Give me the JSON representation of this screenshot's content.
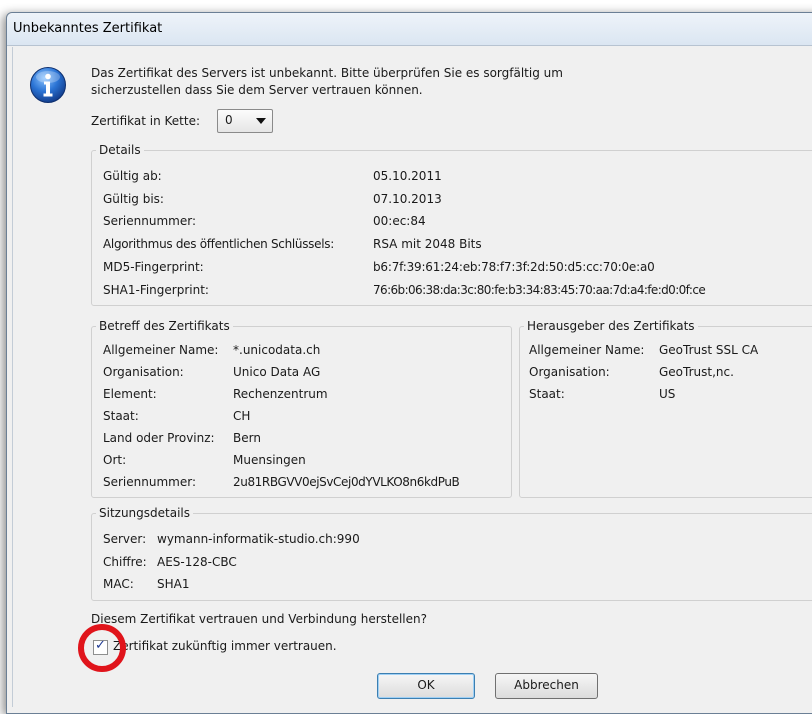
{
  "dialog": {
    "title": "Unbekanntes Zertifikat",
    "message_line1": "Das Zertifikat des Servers ist unbekannt. Bitte überprüfen Sie es sorgfältig um",
    "message_line2": "sicherzustellen dass Sie dem Server vertrauen können.",
    "chain_label": "Zertifikat in Kette:",
    "chain_value": "0",
    "trust_question": "Diesem Zertifikat vertrauen und Verbindung herstellen?",
    "always_trust_label": "Zertifikat zukünftig immer vertrauen.",
    "always_trust_checked": true,
    "ok_label": "OK",
    "cancel_label": "Abbrechen"
  },
  "details": {
    "legend": "Details",
    "rows": [
      {
        "label": "Gültig ab:",
        "value": "05.10.2011"
      },
      {
        "label": "Gültig bis:",
        "value": "07.10.2013"
      },
      {
        "label": "Seriennummer:",
        "value": "00:ec:84"
      },
      {
        "label": "Algorithmus des öffentlichen Schlüssels:",
        "value": "RSA mit 2048 Bits"
      },
      {
        "label": "MD5-Fingerprint:",
        "value": "b6:7f:39:61:24:eb:78:f7:3f:2d:50:d5:cc:70:0e:a0"
      },
      {
        "label": "SHA1-Fingerprint:",
        "value": "76:6b:06:38:da:3c:80:fe:b3:34:83:45:70:aa:7d:a4:fe:d0:0f:ce"
      }
    ]
  },
  "subject": {
    "legend": "Betreff des Zertifikats",
    "rows": [
      {
        "label": "Allgemeiner Name:",
        "value": "*.unicodata.ch"
      },
      {
        "label": "Organisation:",
        "value": "Unico Data AG"
      },
      {
        "label": "Element:",
        "value": "Rechenzentrum"
      },
      {
        "label": "Staat:",
        "value": "CH"
      },
      {
        "label": "Land oder Provinz:",
        "value": "Bern"
      },
      {
        "label": "Ort:",
        "value": "Muensingen"
      },
      {
        "label": "Seriennummer:",
        "value": "2u81RBGVV0ejSvCej0dYVLKO8n6kdPuB"
      }
    ]
  },
  "issuer": {
    "legend": "Herausgeber des Zertifikats",
    "rows": [
      {
        "label": "Allgemeiner Name:",
        "value": "GeoTrust SSL CA"
      },
      {
        "label": "Organisation:",
        "value": "GeoTrust,nc."
      },
      {
        "label": "Staat:",
        "value": "US"
      }
    ]
  },
  "session": {
    "legend": "Sitzungsdetails",
    "rows": [
      {
        "label": "Server:",
        "value": "wymann-informatik-studio.ch:990"
      },
      {
        "label": "Chiffre:",
        "value": "AES-128-CBC"
      },
      {
        "label": "MAC:",
        "value": "SHA1"
      }
    ]
  },
  "icons": {
    "info": "info-icon",
    "dropdown": "chevron-down-icon",
    "check": "checkmark-icon"
  },
  "colors": {
    "highlight_circle": "#e0141b",
    "info_icon": "#1f5fb8"
  }
}
